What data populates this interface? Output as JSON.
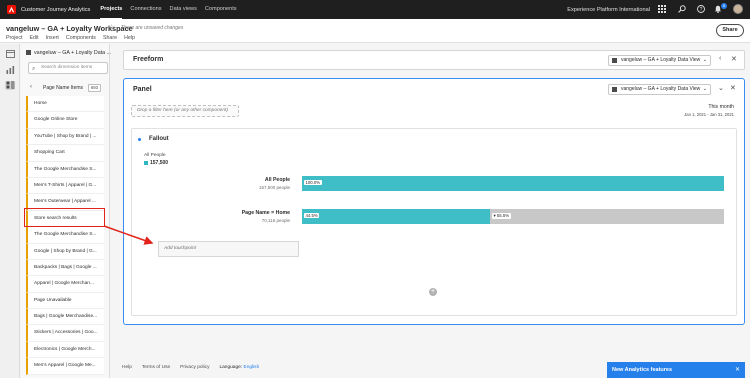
{
  "topbar": {
    "app_name": "Customer Journey Analytics",
    "nav": [
      "Projects",
      "Connections",
      "Data views",
      "Components"
    ],
    "active_nav": "Projects",
    "org": "Experience Platform International",
    "notification_count": "5",
    "icons": [
      "adobe-logo-icon",
      "apps-grid-icon",
      "search-icon",
      "help-icon",
      "bell-icon"
    ]
  },
  "header": {
    "project_title": "vangeluw – GA + Loyalty Workspace",
    "unsaved": "There are unsaved changes",
    "menu": [
      "Project",
      "Edit",
      "Insert",
      "Components",
      "Share",
      "Help"
    ],
    "share_label": "Share"
  },
  "left_panel": {
    "dataview": "vangeluw – GA + Loyalty Data ...",
    "search_placeholder": "Search dimension items",
    "items_title": "Page Name Items",
    "items_count": "693",
    "items": [
      "Home",
      "Google Online Store",
      "YouTube | Shop by Brand | ...",
      "Shopping Cart",
      "The Google Merchandise S...",
      "Men's T-Shirts | Apparel | G...",
      "Men's Outerwear | Apparel ...",
      "Store search results",
      "The Google Merchandise S...",
      "Google | Shop by Brand | G...",
      "Backpacks | Bags | Google ...",
      "Apparel | Google Merchan...",
      "Page Unavailable",
      "Bags | Google Merchandise...",
      "Stickers | Accessories | Goo...",
      "Electronics | Google Merch...",
      "Men's Apparel | Google Me..."
    ]
  },
  "freeform": {
    "title": "Freeform",
    "dataview": "vangeluw – GA + Loyalty Data View"
  },
  "panel": {
    "title": "Panel",
    "dataview": "vangeluw – GA + Loyalty Data View",
    "dropzone": "Drop a filter here (or any other component)",
    "date_label": "This month",
    "date_range": "Jan 1, 2021 - Jan 31, 2021"
  },
  "fallout": {
    "title": "Fallout",
    "segment_name": "All People",
    "segment_value": "157,500",
    "add_touchpoint": "Add touchpoint",
    "accent": "#3fbec8",
    "rows": [
      {
        "label": "All People",
        "sub": "157,500 people",
        "percent_label": "100.0%",
        "fraction": 1.0,
        "dropoff_label": ""
      },
      {
        "label": "Page Name = Home",
        "sub": "70,116 people",
        "percent_label": "44.5%",
        "fraction": 0.445,
        "dropoff_label": "▾ 55.5%"
      }
    ]
  },
  "footer": {
    "links": [
      "Help",
      "Terms of Use",
      "Privacy policy"
    ],
    "language_prefix": "Language:",
    "language": "English"
  },
  "toast": {
    "text": "New Analytics features"
  }
}
